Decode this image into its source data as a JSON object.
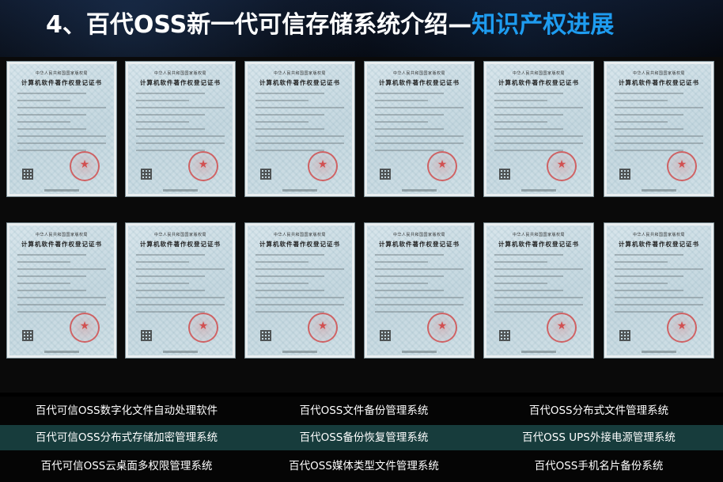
{
  "title": {
    "main": "4、百代OSS新一代可信存储系统介绍—",
    "accent": "知识产权进展"
  },
  "certificate": {
    "issuer": "中华人民共和国国家版权局",
    "heading": "计算机软件著作权登记证书"
  },
  "software_list": [
    [
      "百代可信OSS数字化文件自动处理软件",
      "百代OSS文件备份管理系统",
      "百代OSS分布式文件管理系统"
    ],
    [
      "百代可信OSS分布式存储加密管理系统",
      "百代OSS备份恢复管理系统",
      "百代OSS UPS外接电源管理系统"
    ],
    [
      "百代可信OSS云桌面多权限管理系统",
      "百代OSS媒体类型文件管理系统",
      "百代OSS手机名片备份系统"
    ]
  ],
  "colors": {
    "title_accent": "#1e9cf0",
    "highlight_row": "#173c3c"
  }
}
